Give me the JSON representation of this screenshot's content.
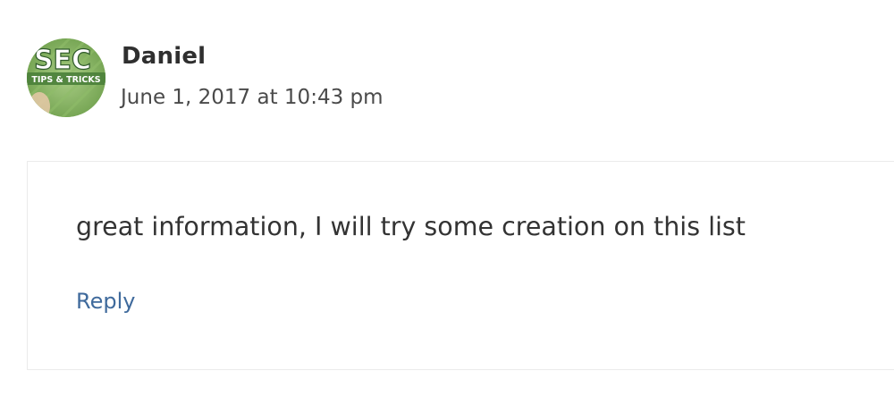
{
  "comment": {
    "author": "Daniel",
    "date": "June 1, 2017 at 10:43 pm",
    "body": "great information, I will try some creation on this list",
    "reply_label": "Reply",
    "avatar": {
      "logo_text": "SEC",
      "logo_subtext": "TIPS & TRICKS",
      "icon": "avatar-logo-icon"
    }
  },
  "colors": {
    "author": "#2f2f2f",
    "date": "#4a4a4a",
    "body": "#333333",
    "reply": "#3f6a9c",
    "avatar_green": "#7fae5a",
    "box_border": "#ebebeb"
  }
}
